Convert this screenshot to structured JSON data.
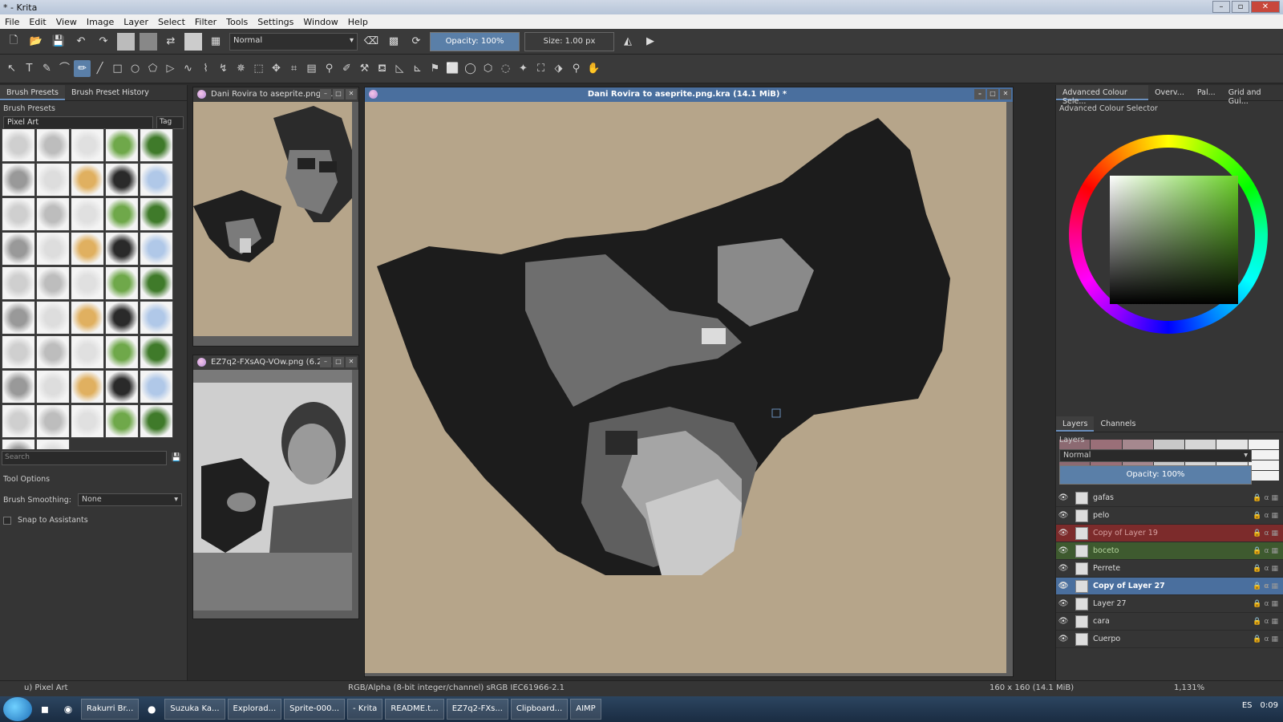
{
  "window": {
    "title": "* - Krita"
  },
  "menu": [
    "File",
    "Edit",
    "View",
    "Image",
    "Layer",
    "Select",
    "Filter",
    "Tools",
    "Settings",
    "Window",
    "Help"
  ],
  "toolbar": {
    "blend_mode": "Normal",
    "opacity": "Opacity: 100%",
    "size": "Size: 1.00 px"
  },
  "left_panel": {
    "tabs": [
      "Brush Presets",
      "Brush Preset History"
    ],
    "title": "Brush Presets",
    "preset_tag": "Pixel Art",
    "tag_label": "Tag",
    "search_placeholder": "Search",
    "tool_options_title": "Tool Options",
    "brush_smoothing_label": "Brush Smoothing:",
    "brush_smoothing_value": "None",
    "snap_label": "Snap to Assistants"
  },
  "docs": {
    "doc1_title": "Dani Rovira to aseprite.png.kr...",
    "doc2_title": "EZ7q2-FXsAQ-VOw.png (6.2 ...",
    "main_title": "Dani Rovira to aseprite.png.kra (14.1 MiB) *"
  },
  "right_panel": {
    "tabs": [
      "Advanced Colour Sele...",
      "Overv...",
      "Pal...",
      "Grid and Gui..."
    ],
    "color_title": "Advanced Colour Selector",
    "layers_tabs": [
      "Layers",
      "Channels"
    ],
    "layers_title": "Layers",
    "layers_blend": "Normal",
    "layers_opacity": "Opacity:  100%",
    "layers": [
      {
        "name": "gafas",
        "style": ""
      },
      {
        "name": "pelo",
        "style": ""
      },
      {
        "name": "Copy of Layer 19",
        "style": "red"
      },
      {
        "name": "boceto",
        "style": "green"
      },
      {
        "name": "Perrete",
        "style": ""
      },
      {
        "name": "Copy of Layer 27",
        "style": "sel"
      },
      {
        "name": "Layer 27",
        "style": ""
      },
      {
        "name": "cara",
        "style": ""
      },
      {
        "name": "Cuerpo",
        "style": ""
      }
    ]
  },
  "status": {
    "preset": "u) Pixel Art",
    "color_info": "RGB/Alpha (8-bit integer/channel)  sRGB IEC61966-2.1",
    "size_info": "160 x 160 (14.1 MiB)",
    "zoom": "1,131%"
  },
  "taskbar": {
    "items": [
      "Rakurri Br...",
      "Suzuka Ka...",
      "Explorad...",
      "Sprite-000...",
      "- Krita",
      "README.t...",
      "EZ7q2-FXs...",
      "Clipboard...",
      "AIMP"
    ],
    "lang": "ES",
    "clock": "0:09"
  }
}
